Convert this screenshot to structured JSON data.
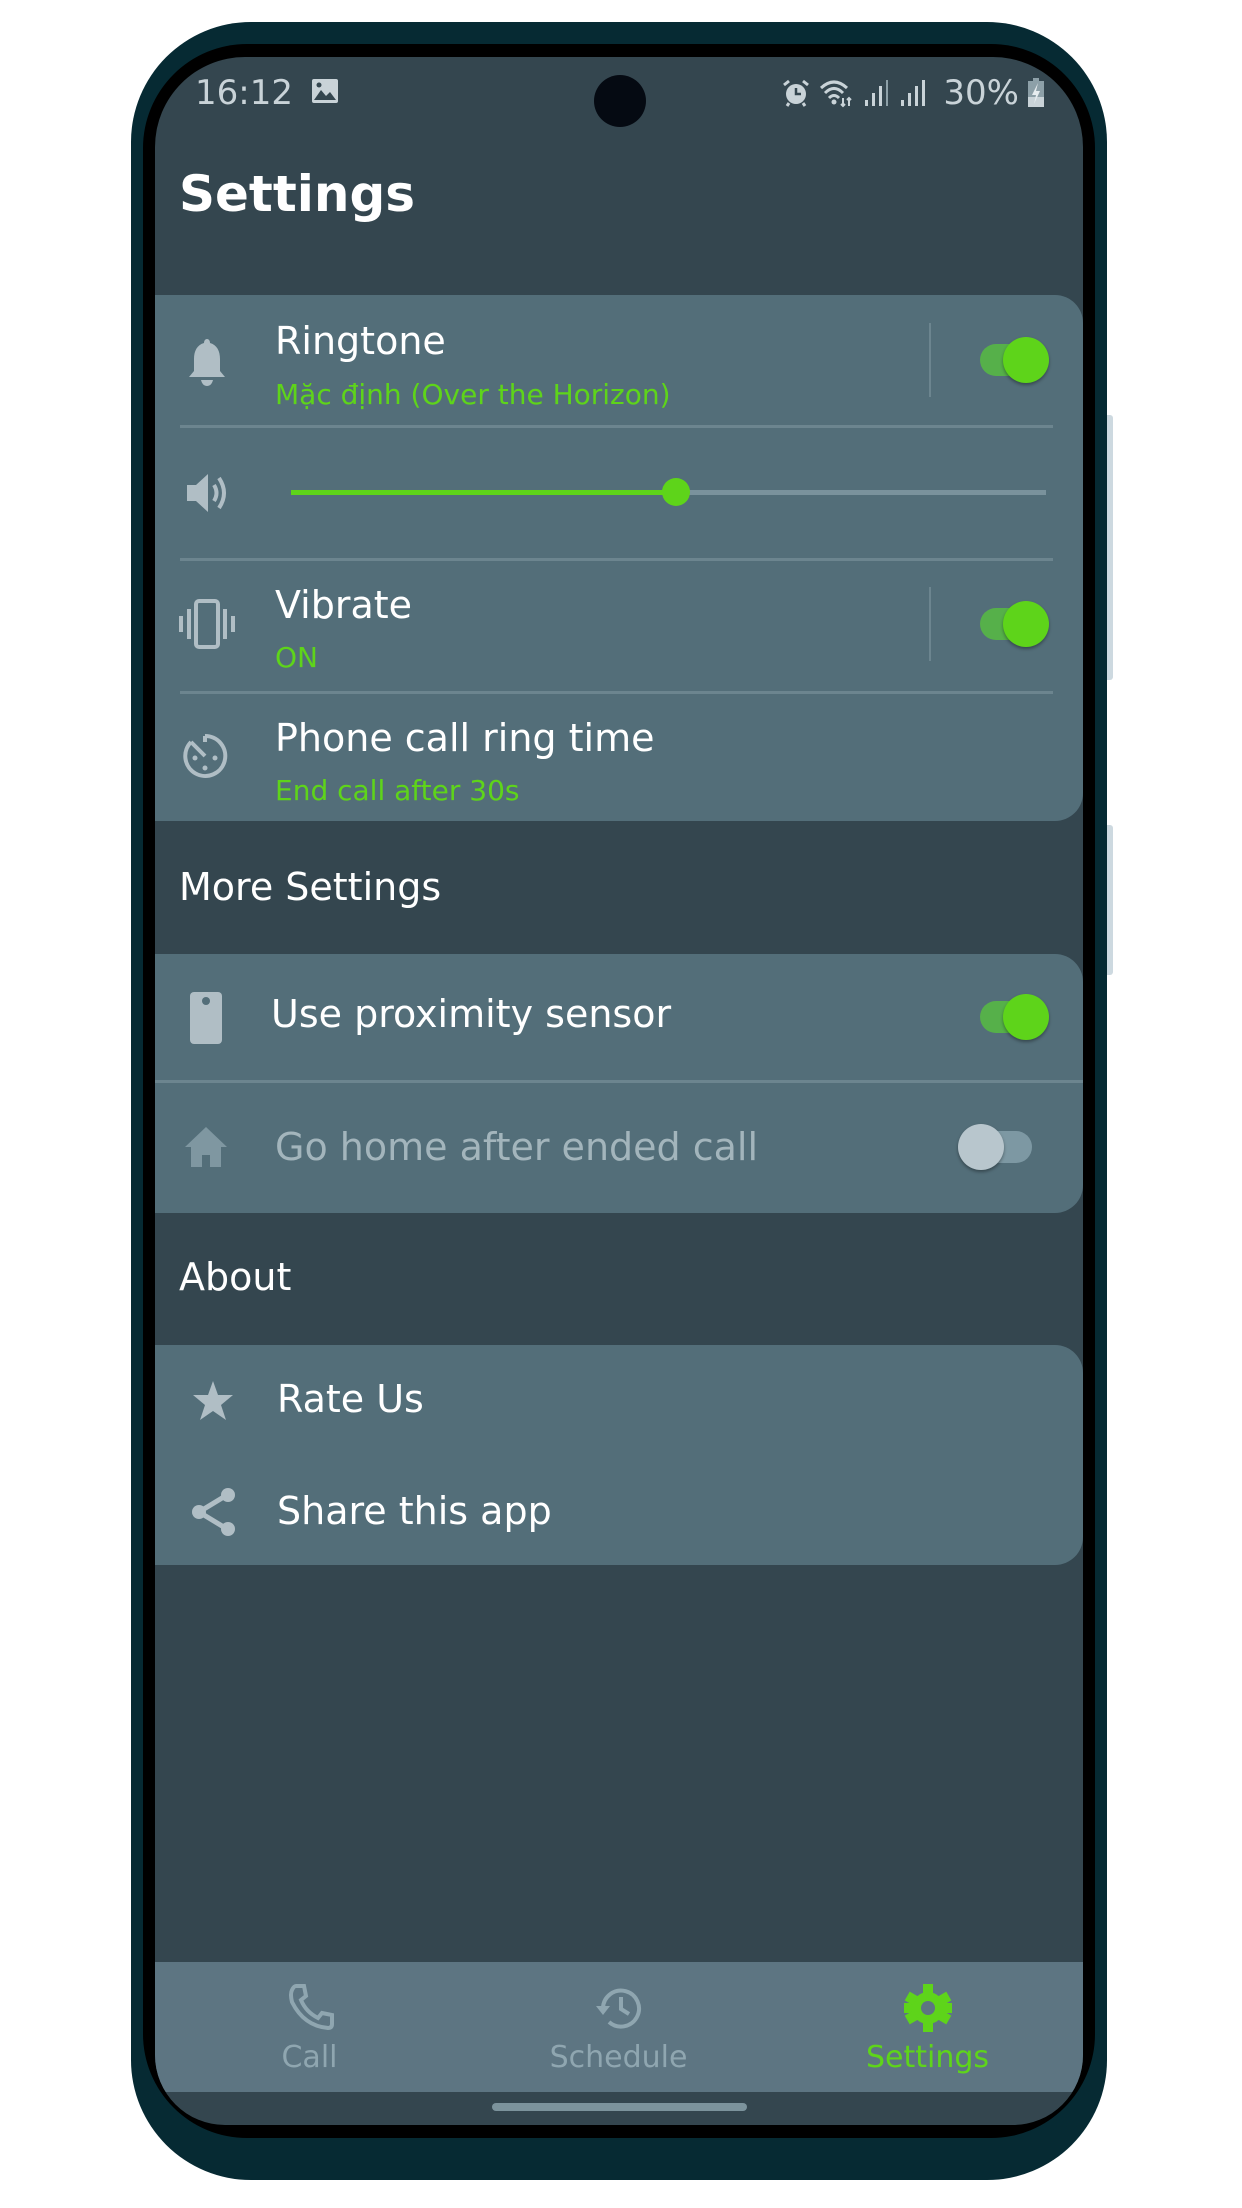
{
  "status_bar": {
    "time": "16:12",
    "battery": "30%",
    "icons": [
      "gallery-icon",
      "alarm-icon",
      "wifi-icon",
      "signal-icon",
      "signal-icon",
      "battery-charging-icon"
    ]
  },
  "page": {
    "title": "Settings"
  },
  "colors": {
    "accent": "#5ed41a",
    "background": "#34464f",
    "card": "#536e79",
    "icon": "#b0bec5",
    "nav": "#5d7582"
  },
  "ringtone_card": {
    "ringtone": {
      "icon": "bell-icon",
      "title": "Ringtone",
      "subtitle": "Mặc định (Over the Horizon)",
      "enabled": true
    },
    "volume": {
      "icon": "volume-icon",
      "value": 0.51
    },
    "vibrate": {
      "icon": "vibrate-icon",
      "title": "Vibrate",
      "subtitle": "ON",
      "enabled": true
    },
    "ring_time": {
      "icon": "timer-icon",
      "title": "Phone call ring time",
      "subtitle": "End call after 30s"
    }
  },
  "more_settings": {
    "title": "More Settings",
    "items": [
      {
        "icon": "phone-sensor-icon",
        "label": "Use proximity sensor",
        "enabled": true
      },
      {
        "icon": "home-icon",
        "label": "Go home after ended call",
        "enabled": false
      }
    ]
  },
  "about": {
    "title": "About",
    "items": [
      {
        "icon": "star-icon",
        "label": "Rate Us"
      },
      {
        "icon": "share-icon",
        "label": "Share this app"
      }
    ]
  },
  "bottom_nav": {
    "items": [
      {
        "icon": "phone-icon",
        "label": "Call",
        "active": false
      },
      {
        "icon": "history-icon",
        "label": "Schedule",
        "active": false
      },
      {
        "icon": "gear-icon",
        "label": "Settings",
        "active": true
      }
    ]
  }
}
